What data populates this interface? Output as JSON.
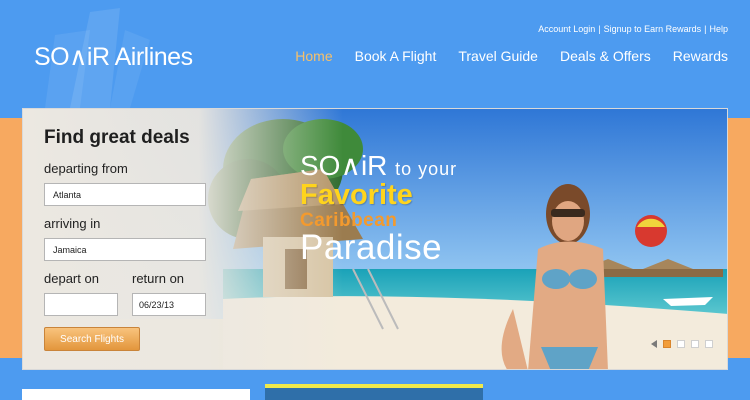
{
  "header": {
    "logo_text": "SO∧iR Airlines",
    "util_links": [
      "Account Login",
      "Signup to Earn Rewards",
      "Help"
    ],
    "nav": [
      {
        "label": "Home",
        "active": true
      },
      {
        "label": "Book A Flight",
        "active": false
      },
      {
        "label": "Travel Guide",
        "active": false
      },
      {
        "label": "Deals & Offers",
        "active": false
      },
      {
        "label": "Rewards",
        "active": false
      }
    ]
  },
  "search": {
    "title": "Find great deals",
    "departing_label": "departing from",
    "departing_value": "Atlanta",
    "arriving_label": "arriving in",
    "arriving_value": "Jamaica",
    "depart_label": "depart on",
    "depart_value": "",
    "return_label": "return on",
    "return_value": "06/23/13",
    "button_label": "Search Flights"
  },
  "hero": {
    "brand": "SO∧iR",
    "line1_rest": "to your",
    "line2": "Favorite",
    "line3": "Caribbean",
    "line4": "Paradise"
  },
  "carousel": {
    "slide_count": 4,
    "active_index": 0
  },
  "colors": {
    "header_blue": "#4d9bf0",
    "band_orange": "#f7a960",
    "active_nav": "#f6c06a",
    "slogan_yellow": "#ffd41c",
    "slogan_orange": "#f39a2e"
  }
}
